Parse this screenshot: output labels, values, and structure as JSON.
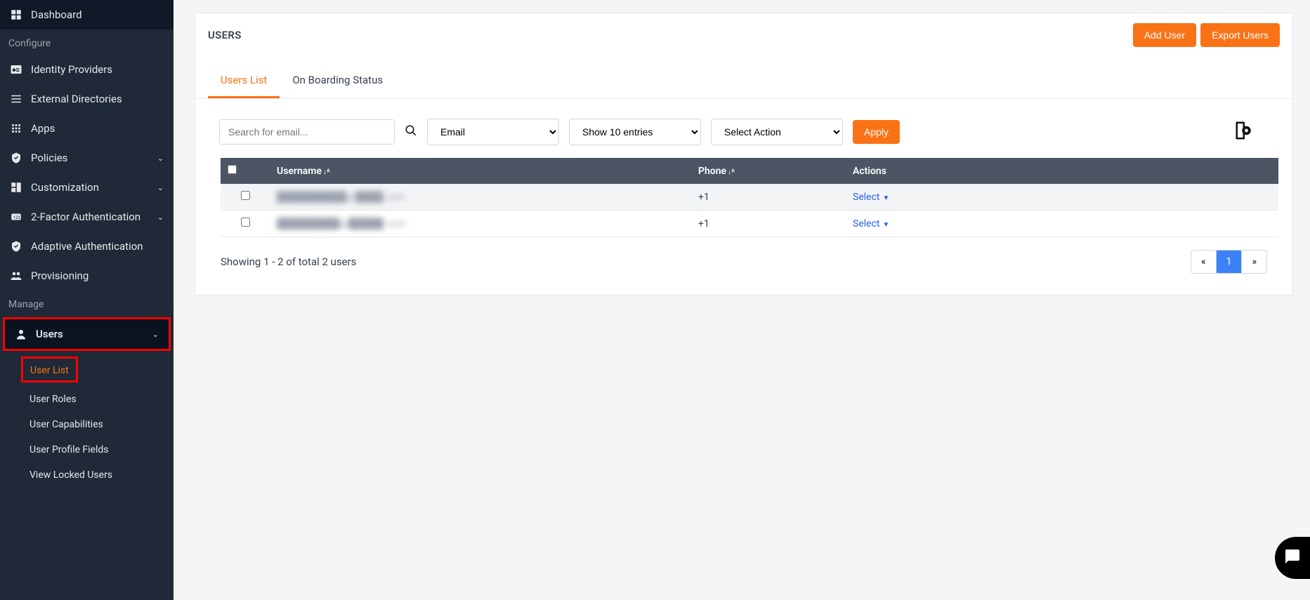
{
  "sidebar": {
    "dashboard": "Dashboard",
    "section_configure": "Configure",
    "identity_providers": "Identity Providers",
    "external_directories": "External Directories",
    "apps": "Apps",
    "policies": "Policies",
    "customization": "Customization",
    "two_factor": "2-Factor Authentication",
    "adaptive_auth": "Adaptive Authentication",
    "provisioning": "Provisioning",
    "section_manage": "Manage",
    "users": "Users",
    "sub_user_list": "User List",
    "sub_user_roles": "User Roles",
    "sub_user_capabilities": "User Capabilities",
    "sub_user_profile_fields": "User Profile Fields",
    "sub_view_locked": "View Locked Users"
  },
  "header": {
    "title": "USERS",
    "add_user": "Add User",
    "export_users": "Export Users"
  },
  "tabs": {
    "users_list": "Users List",
    "onboarding": "On Boarding Status"
  },
  "controls": {
    "search_placeholder": "Search for email...",
    "filter_field": "Email",
    "entries": "Show 10 entries",
    "action": "Select Action",
    "apply": "Apply"
  },
  "table": {
    "col_username": "Username",
    "col_phone": "Phone",
    "col_actions": "Actions",
    "rows": [
      {
        "username": "██████████@████.com",
        "phone": "+1",
        "action": "Select"
      },
      {
        "username": "█████████@█████.com",
        "phone": "+1",
        "action": "Select"
      }
    ]
  },
  "footer": {
    "showing": "Showing 1 - 2 of total 2 users",
    "prev": "«",
    "page": "1",
    "next": "»"
  }
}
